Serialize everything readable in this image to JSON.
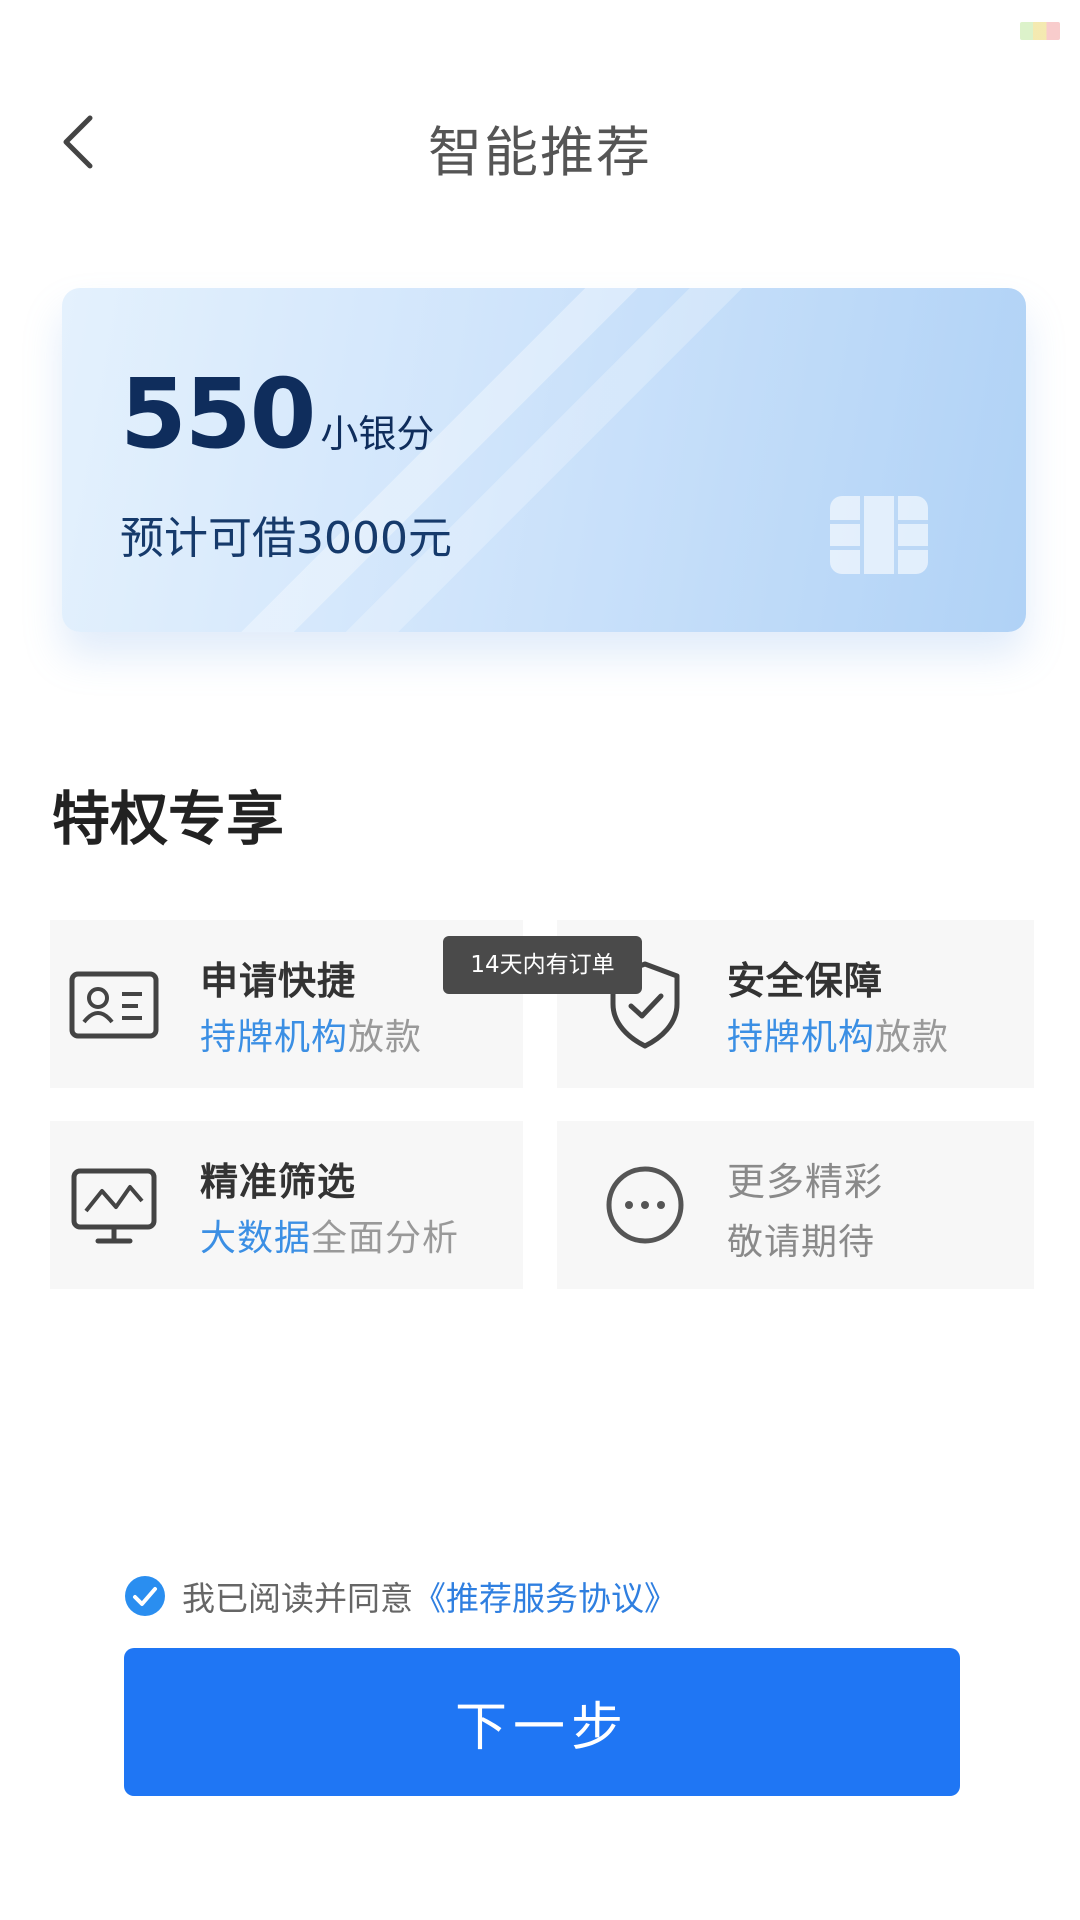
{
  "header": {
    "title": "智能推荐"
  },
  "card": {
    "score": "550",
    "score_unit": "小银分",
    "estimate": "预计可借3000元"
  },
  "section_title": "特权专享",
  "features": [
    {
      "title": "申请快捷",
      "sub_highlight": "持牌机构",
      "sub_rest": "放款",
      "icon": "id-card-icon"
    },
    {
      "title": "安全保障",
      "sub_highlight": "持牌机构",
      "sub_rest": "放款",
      "icon": "shield-check-icon"
    },
    {
      "title": "精准筛选",
      "sub_highlight": "大数据",
      "sub_rest": "全面分析",
      "icon": "monitor-chart-icon"
    },
    {
      "title": "更多精彩",
      "sub_rest": "敬请期待",
      "icon": "more-dots-icon"
    }
  ],
  "tooltip": "14天内有订单",
  "agreement": {
    "text": "我已阅读并同意",
    "link": "《推荐服务协议》",
    "checked": true
  },
  "next_button": "下一步",
  "colors": {
    "primary": "#1f76f4",
    "highlight": "#3b8fe4",
    "score": "#0f2d5c"
  }
}
